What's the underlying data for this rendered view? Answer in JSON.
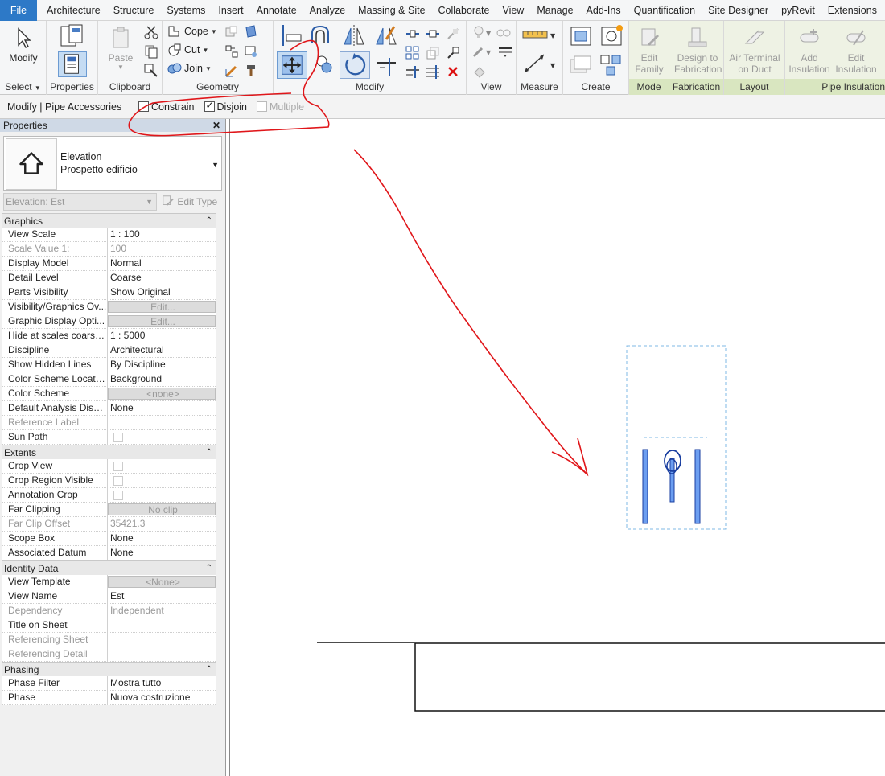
{
  "menu": {
    "tabs": [
      "File",
      "Architecture",
      "Structure",
      "Systems",
      "Insert",
      "Annotate",
      "Analyze",
      "Massing & Site",
      "Collaborate",
      "View",
      "Manage",
      "Add-Ins",
      "Quantification",
      "Site Designer",
      "pyRevit",
      "Extensions"
    ]
  },
  "ribbon": {
    "select": {
      "modify_label": "Modify",
      "title": "Select"
    },
    "properties": {
      "title": "Properties"
    },
    "clipboard": {
      "paste_label": "Paste",
      "title": "Clipboard"
    },
    "geometry": {
      "cope_label": "Cope",
      "cut_label": "Cut",
      "join_label": "Join",
      "title": "Geometry"
    },
    "modify": {
      "title": "Modify"
    },
    "view": {
      "title": "View"
    },
    "measure": {
      "title": "Measure"
    },
    "create": {
      "title": "Create"
    },
    "mode": {
      "edit_family_label": "Edit Family",
      "title": "Mode"
    },
    "fabrication": {
      "design_label": "Design to Fabrication",
      "title": "Fabrication"
    },
    "layout": {
      "air_terminal_label": "Air Terminal on Duct",
      "title": "Layout"
    },
    "pipe_insulation": {
      "add_label": "Add Insulation",
      "edit_label": "Edit Insulation",
      "title": "Pipe Insulation"
    }
  },
  "options_bar": {
    "context": "Modify | Pipe Accessories",
    "constrain": "Constrain",
    "disjoin": "Disjoin",
    "multiple": "Multiple"
  },
  "properties": {
    "title": "Properties",
    "type_family": "Elevation",
    "type_name": "Prospetto edificio",
    "instance_selector": "Elevation: Est",
    "edit_type": "Edit Type",
    "groups": [
      {
        "name": "Graphics",
        "rows": [
          {
            "name": "View Scale",
            "value": "1 : 100"
          },
          {
            "name": "Scale Value    1:",
            "value": "100",
            "readonly": true
          },
          {
            "name": "Display Model",
            "value": "Normal"
          },
          {
            "name": "Detail Level",
            "value": "Coarse"
          },
          {
            "name": "Parts Visibility",
            "value": "Show Original"
          },
          {
            "name": "Visibility/Graphics Ov...",
            "value": "Edit...",
            "button": true
          },
          {
            "name": "Graphic Display Opti...",
            "value": "Edit...",
            "button": true
          },
          {
            "name": "Hide at scales coarser...",
            "value": "1 : 5000"
          },
          {
            "name": "Discipline",
            "value": "Architectural"
          },
          {
            "name": "Show Hidden Lines",
            "value": "By Discipline"
          },
          {
            "name": "Color Scheme Location",
            "value": "Background"
          },
          {
            "name": "Color Scheme",
            "value": "<none>",
            "button": true
          },
          {
            "name": "Default Analysis Displ...",
            "value": "None"
          },
          {
            "name": "Reference Label",
            "value": "",
            "readonly": true
          },
          {
            "name": "Sun Path",
            "value": "",
            "checkbox": true
          }
        ]
      },
      {
        "name": "Extents",
        "rows": [
          {
            "name": "Crop View",
            "value": "",
            "checkbox": true
          },
          {
            "name": "Crop Region Visible",
            "value": "",
            "checkbox": true
          },
          {
            "name": "Annotation Crop",
            "value": "",
            "checkbox": true
          },
          {
            "name": "Far Clipping",
            "value": "No clip",
            "button": true
          },
          {
            "name": "Far Clip Offset",
            "value": "35421.3",
            "readonly": true
          },
          {
            "name": "Scope Box",
            "value": "None"
          },
          {
            "name": "Associated Datum",
            "value": "None"
          }
        ]
      },
      {
        "name": "Identity Data",
        "rows": [
          {
            "name": "View Template",
            "value": "<None>",
            "button": true
          },
          {
            "name": "View Name",
            "value": "Est"
          },
          {
            "name": "Dependency",
            "value": "Independent",
            "readonly": true
          },
          {
            "name": "Title on Sheet",
            "value": ""
          },
          {
            "name": "Referencing Sheet",
            "value": "",
            "readonly": true
          },
          {
            "name": "Referencing Detail",
            "value": "",
            "readonly": true
          }
        ]
      },
      {
        "name": "Phasing",
        "rows": [
          {
            "name": "Phase Filter",
            "value": "Mostra tutto"
          },
          {
            "name": "Phase",
            "value": "Nuova costruzione"
          }
        ]
      }
    ]
  },
  "colors": {
    "file_tab": "#2d79c7",
    "annotation": "#e0161a",
    "selection": "#3c78d8",
    "crop_dashed": "#7fb8e6"
  }
}
